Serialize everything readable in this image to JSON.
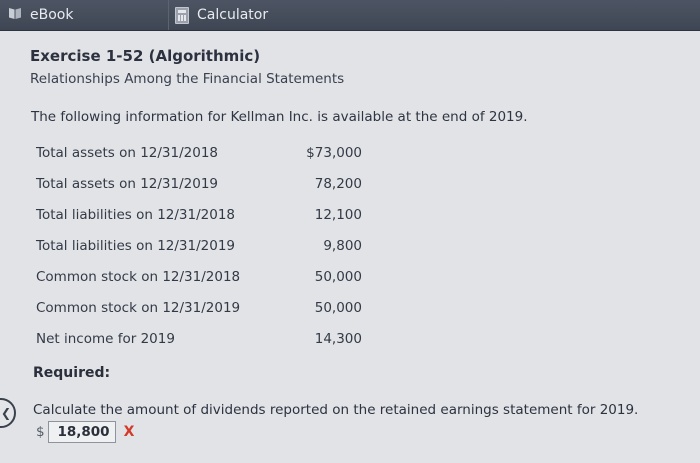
{
  "tabs": {
    "ebook": "eBook",
    "calculator": "Calculator"
  },
  "exercise": {
    "title": "Exercise 1-52 (Algorithmic)",
    "subtitle": "Relationships Among the Financial Statements",
    "intro": "The following information for Kellman Inc. is available at the end of 2019."
  },
  "info": [
    {
      "label": "Total assets on 12/31/2018",
      "value": "$73,000"
    },
    {
      "label": "Total assets on 12/31/2019",
      "value": "78,200"
    },
    {
      "label": "Total liabilities on 12/31/2018",
      "value": "12,100"
    },
    {
      "label": "Total liabilities on 12/31/2019",
      "value": "9,800"
    },
    {
      "label": "Common stock on 12/31/2018",
      "value": "50,000"
    },
    {
      "label": "Common stock on 12/31/2019",
      "value": "50,000"
    },
    {
      "label": "Net income for 2019",
      "value": "14,300"
    }
  ],
  "required": {
    "heading": "Required:",
    "question": "Calculate the amount of dividends reported on the retained earnings statement for 2019.",
    "currency": "$",
    "answer": "18,800",
    "result_mark": "X"
  },
  "colors": {
    "topbar": "#434a57",
    "incorrect": "#d23b2a"
  }
}
